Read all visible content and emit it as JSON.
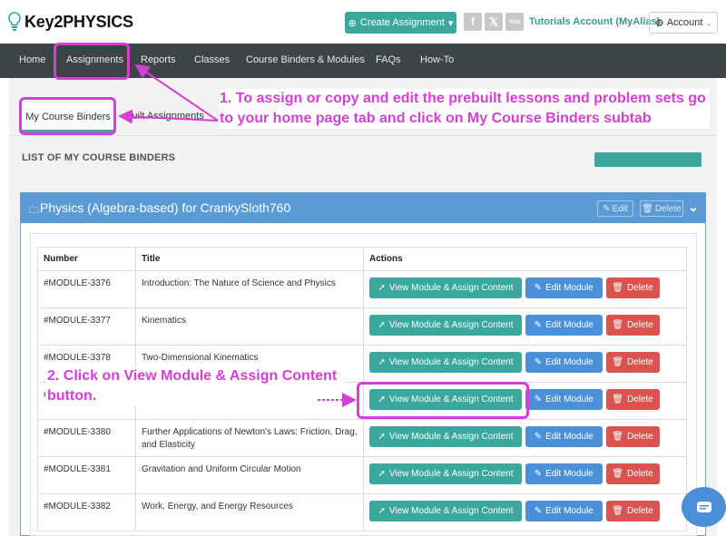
{
  "header": {
    "logo_text": "Key2PHYSICS",
    "create_label": "Create Assignment",
    "social": [
      "f",
      "𝕏",
      "You"
    ],
    "tutorials": "Tutorials Account (MyAlias)",
    "account_label": "Account"
  },
  "nav": [
    "Home",
    "Assignments",
    "Reports",
    "Classes",
    "Course Binders & Modules",
    "FAQs",
    "How-To"
  ],
  "tabs": {
    "binders": "My Course Binders",
    "built": "Built Assignments"
  },
  "list_title": "LIST OF MY COURSE BINDERS",
  "panel": {
    "title": "Physics (Algebra-based) for CrankySloth760",
    "edit": "Edit",
    "delete": "Delete"
  },
  "table": {
    "headers": [
      "Number",
      "Title",
      "Actions"
    ],
    "rows": [
      {
        "number": "#MODULE-3376",
        "title": "Introduction: The Nature of Science and Physics"
      },
      {
        "number": "#MODULE-3377",
        "title": "Kinematics"
      },
      {
        "number": "#MODULE-3378",
        "title": "Two-Dimensional Kinematics"
      },
      {
        "number": "#MODULE-3379",
        "title": ""
      },
      {
        "number": "#MODULE-3380",
        "title": "Further Applications of Newton's Laws: Friction, Drag, and Elasticity"
      },
      {
        "number": "#MODULE-3381",
        "title": "Gravitation and Uniform Circular Motion"
      },
      {
        "number": "#MODULE-3382",
        "title": "Work, Energy, and Energy Resources"
      }
    ],
    "view_label": "View Module & Assign Content",
    "edit_label": "Edit Module",
    "delete_label": "Delete"
  },
  "annotations": {
    "step1": "1. To assign or copy and edit the prebuilt lessons and problem sets go to your home page tab and click on My Course Binders subtab",
    "step2": "2. Click on View Module & Assign Content button."
  },
  "colors": {
    "accent": "#3aa89d",
    "blue": "#4a90d9",
    "red": "#d9534f",
    "annotation": "#d63fd6",
    "nav": "#3d4447"
  }
}
